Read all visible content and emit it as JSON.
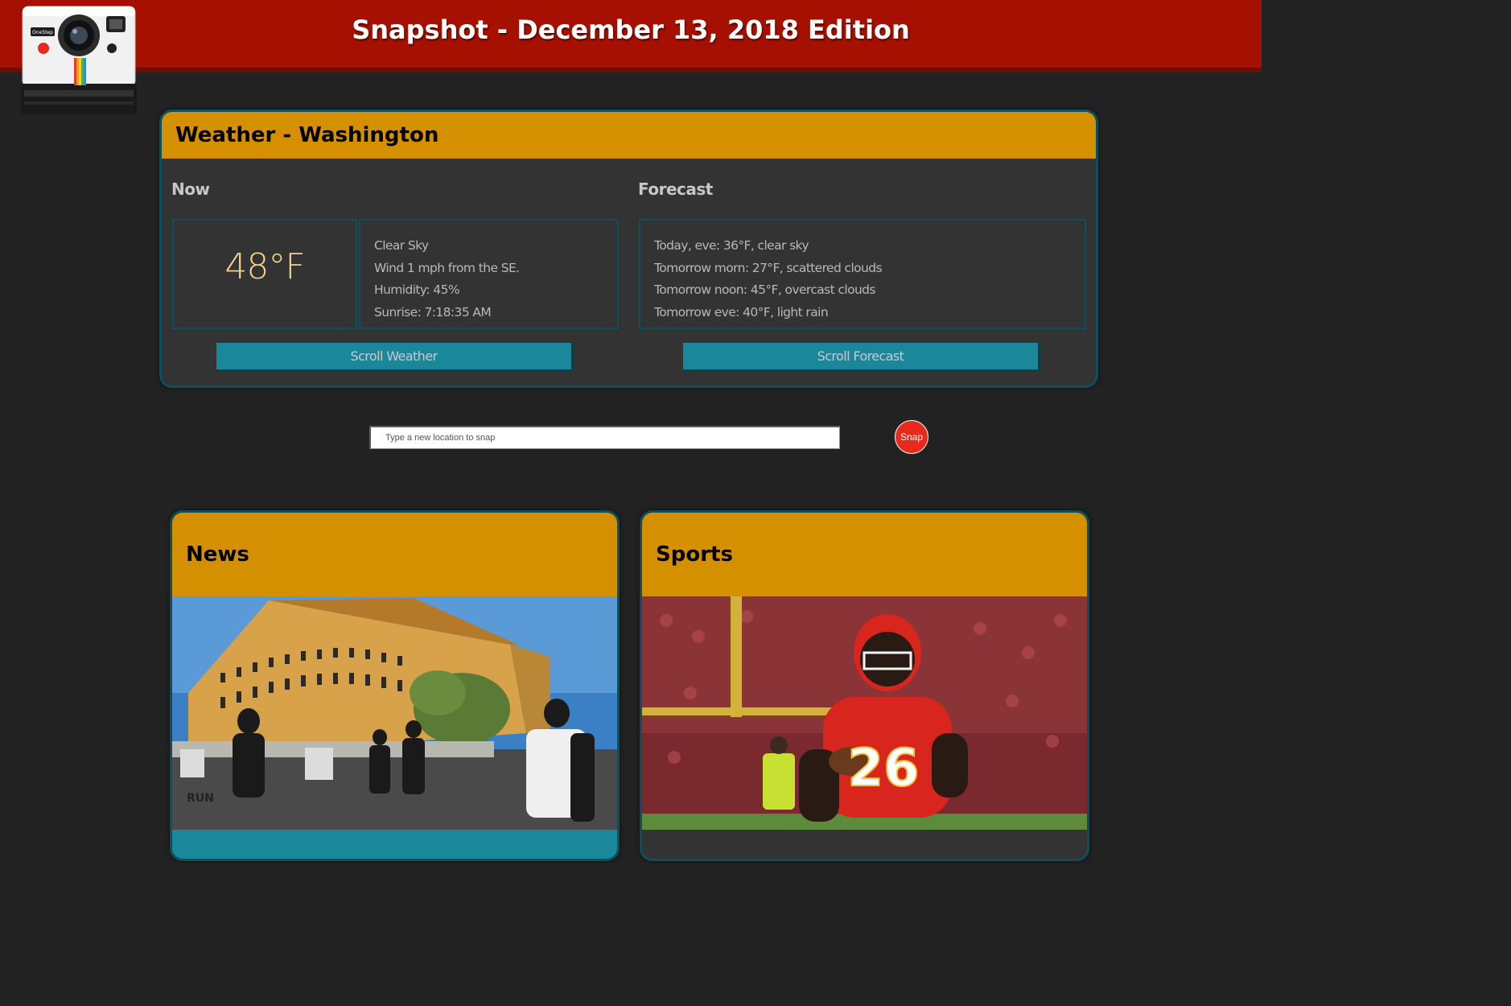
{
  "header": {
    "title": "Snapshot - December 13, 2018 Edition"
  },
  "logo": {
    "brand_text": "OneStep"
  },
  "weather": {
    "title": "Weather - Washington",
    "now_label": "Now",
    "forecast_label": "Forecast",
    "temperature": "48°F",
    "details": [
      "Clear Sky",
      "Wind 1 mph from the SE.",
      "Humidity: 45%",
      "Sunrise: 7:18:35 AM"
    ],
    "forecast": [
      "Today, eve: 36°F, clear sky",
      "Tomorrow morn: 27°F, scattered clouds",
      "Tomorrow noon: 45°F, overcast clouds",
      "Tomorrow eve: 40°F, light rain"
    ],
    "scroll_weather_label": "Scroll Weather",
    "scroll_forecast_label": "Scroll Forecast"
  },
  "search": {
    "placeholder": "Type a new location to snap",
    "value": "",
    "snap_label": "Snap"
  },
  "news": {
    "title": "News",
    "photo_caption_sign": "RUN"
  },
  "sports": {
    "title": "Sports",
    "jersey_number": "26"
  },
  "colors": {
    "header_bg": "#a61000",
    "card_head": "#d49000",
    "accent_teal": "#1b879a",
    "snap_red": "#e8291c",
    "page_bg": "#222222",
    "temp_color": "#f0d28a"
  }
}
